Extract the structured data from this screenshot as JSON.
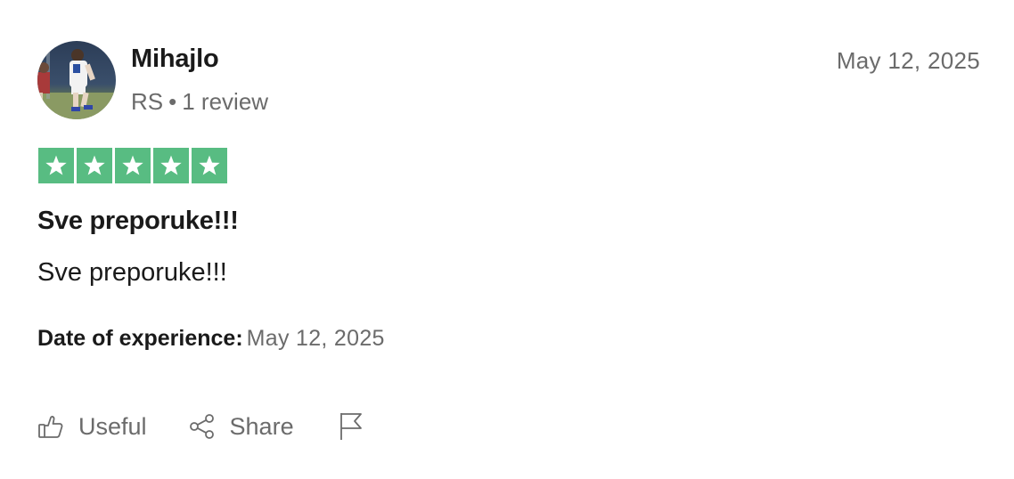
{
  "reviewer": {
    "name": "Mihajlo",
    "country": "RS",
    "separator": "•",
    "review_count": "1 review",
    "avatar": "avatar-photo"
  },
  "review": {
    "date": "May 12, 2025",
    "rating": 5,
    "rating_max": 5,
    "star_color": "#58bc82",
    "title": "Sve preporuke!!!",
    "body": "Sve preporuke!!!",
    "experience_label": "Date of experience:",
    "experience_date": "May 12, 2025"
  },
  "actions": {
    "useful_label": "Useful",
    "useful_icon": "thumbs-up-icon",
    "share_label": "Share",
    "share_icon": "share-icon",
    "report_icon": "flag-icon"
  }
}
